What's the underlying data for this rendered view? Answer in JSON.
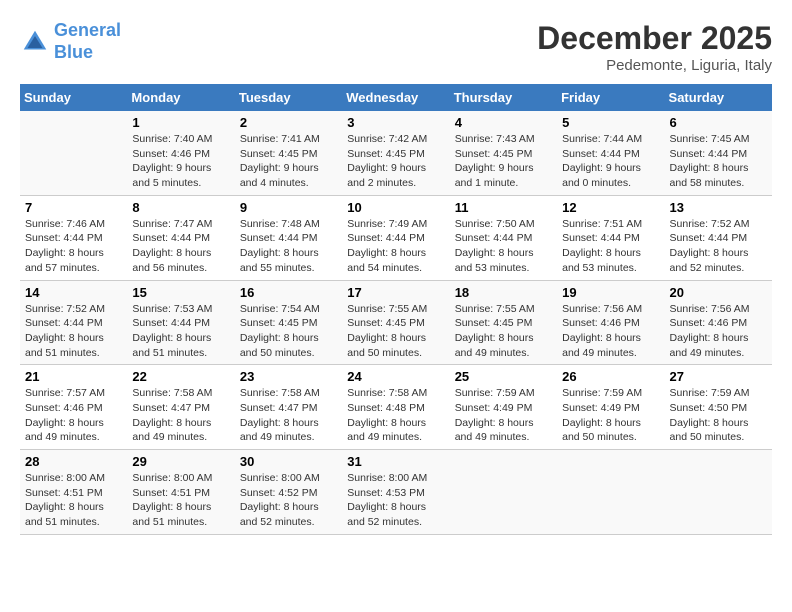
{
  "header": {
    "logo_line1": "General",
    "logo_line2": "Blue",
    "month": "December 2025",
    "location": "Pedemonte, Liguria, Italy"
  },
  "weekdays": [
    "Sunday",
    "Monday",
    "Tuesday",
    "Wednesday",
    "Thursday",
    "Friday",
    "Saturday"
  ],
  "weeks": [
    [
      {
        "day": "",
        "text": ""
      },
      {
        "day": "1",
        "text": "Sunrise: 7:40 AM\nSunset: 4:46 PM\nDaylight: 9 hours\nand 5 minutes."
      },
      {
        "day": "2",
        "text": "Sunrise: 7:41 AM\nSunset: 4:45 PM\nDaylight: 9 hours\nand 4 minutes."
      },
      {
        "day": "3",
        "text": "Sunrise: 7:42 AM\nSunset: 4:45 PM\nDaylight: 9 hours\nand 2 minutes."
      },
      {
        "day": "4",
        "text": "Sunrise: 7:43 AM\nSunset: 4:45 PM\nDaylight: 9 hours\nand 1 minute."
      },
      {
        "day": "5",
        "text": "Sunrise: 7:44 AM\nSunset: 4:44 PM\nDaylight: 9 hours\nand 0 minutes."
      },
      {
        "day": "6",
        "text": "Sunrise: 7:45 AM\nSunset: 4:44 PM\nDaylight: 8 hours\nand 58 minutes."
      }
    ],
    [
      {
        "day": "7",
        "text": "Sunrise: 7:46 AM\nSunset: 4:44 PM\nDaylight: 8 hours\nand 57 minutes."
      },
      {
        "day": "8",
        "text": "Sunrise: 7:47 AM\nSunset: 4:44 PM\nDaylight: 8 hours\nand 56 minutes."
      },
      {
        "day": "9",
        "text": "Sunrise: 7:48 AM\nSunset: 4:44 PM\nDaylight: 8 hours\nand 55 minutes."
      },
      {
        "day": "10",
        "text": "Sunrise: 7:49 AM\nSunset: 4:44 PM\nDaylight: 8 hours\nand 54 minutes."
      },
      {
        "day": "11",
        "text": "Sunrise: 7:50 AM\nSunset: 4:44 PM\nDaylight: 8 hours\nand 53 minutes."
      },
      {
        "day": "12",
        "text": "Sunrise: 7:51 AM\nSunset: 4:44 PM\nDaylight: 8 hours\nand 53 minutes."
      },
      {
        "day": "13",
        "text": "Sunrise: 7:52 AM\nSunset: 4:44 PM\nDaylight: 8 hours\nand 52 minutes."
      }
    ],
    [
      {
        "day": "14",
        "text": "Sunrise: 7:52 AM\nSunset: 4:44 PM\nDaylight: 8 hours\nand 51 minutes."
      },
      {
        "day": "15",
        "text": "Sunrise: 7:53 AM\nSunset: 4:44 PM\nDaylight: 8 hours\nand 51 minutes."
      },
      {
        "day": "16",
        "text": "Sunrise: 7:54 AM\nSunset: 4:45 PM\nDaylight: 8 hours\nand 50 minutes."
      },
      {
        "day": "17",
        "text": "Sunrise: 7:55 AM\nSunset: 4:45 PM\nDaylight: 8 hours\nand 50 minutes."
      },
      {
        "day": "18",
        "text": "Sunrise: 7:55 AM\nSunset: 4:45 PM\nDaylight: 8 hours\nand 49 minutes."
      },
      {
        "day": "19",
        "text": "Sunrise: 7:56 AM\nSunset: 4:46 PM\nDaylight: 8 hours\nand 49 minutes."
      },
      {
        "day": "20",
        "text": "Sunrise: 7:56 AM\nSunset: 4:46 PM\nDaylight: 8 hours\nand 49 minutes."
      }
    ],
    [
      {
        "day": "21",
        "text": "Sunrise: 7:57 AM\nSunset: 4:46 PM\nDaylight: 8 hours\nand 49 minutes."
      },
      {
        "day": "22",
        "text": "Sunrise: 7:58 AM\nSunset: 4:47 PM\nDaylight: 8 hours\nand 49 minutes."
      },
      {
        "day": "23",
        "text": "Sunrise: 7:58 AM\nSunset: 4:47 PM\nDaylight: 8 hours\nand 49 minutes."
      },
      {
        "day": "24",
        "text": "Sunrise: 7:58 AM\nSunset: 4:48 PM\nDaylight: 8 hours\nand 49 minutes."
      },
      {
        "day": "25",
        "text": "Sunrise: 7:59 AM\nSunset: 4:49 PM\nDaylight: 8 hours\nand 49 minutes."
      },
      {
        "day": "26",
        "text": "Sunrise: 7:59 AM\nSunset: 4:49 PM\nDaylight: 8 hours\nand 50 minutes."
      },
      {
        "day": "27",
        "text": "Sunrise: 7:59 AM\nSunset: 4:50 PM\nDaylight: 8 hours\nand 50 minutes."
      }
    ],
    [
      {
        "day": "28",
        "text": "Sunrise: 8:00 AM\nSunset: 4:51 PM\nDaylight: 8 hours\nand 51 minutes."
      },
      {
        "day": "29",
        "text": "Sunrise: 8:00 AM\nSunset: 4:51 PM\nDaylight: 8 hours\nand 51 minutes."
      },
      {
        "day": "30",
        "text": "Sunrise: 8:00 AM\nSunset: 4:52 PM\nDaylight: 8 hours\nand 52 minutes."
      },
      {
        "day": "31",
        "text": "Sunrise: 8:00 AM\nSunset: 4:53 PM\nDaylight: 8 hours\nand 52 minutes."
      },
      {
        "day": "",
        "text": ""
      },
      {
        "day": "",
        "text": ""
      },
      {
        "day": "",
        "text": ""
      }
    ]
  ]
}
